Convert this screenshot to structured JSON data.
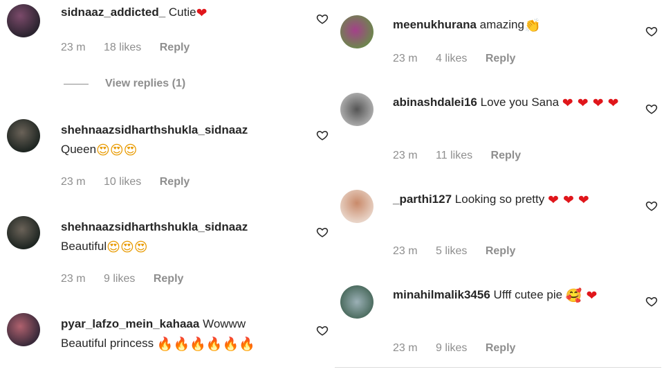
{
  "left": [
    {
      "user": "sidnaaz_addicted_",
      "text": "Cutie",
      "emoji": "❤",
      "emoji_color": "#e0161b",
      "time": "23 m",
      "likes": "18 likes",
      "reply": "Reply"
    },
    {
      "user": "shehnaazsidharthshukla_sidnaaz",
      "text": "Queen",
      "emoji": "😍😍😍",
      "emoji_color": "#f5a623",
      "time": "23 m",
      "likes": "10 likes",
      "reply": "Reply"
    },
    {
      "user": "shehnaazsidharthshukla_sidnaaz",
      "text": "Beautiful",
      "emoji": "😍😍😍",
      "emoji_color": "#f5a623",
      "time": "23 m",
      "likes": "9 likes",
      "reply": "Reply"
    },
    {
      "user": "pyar_lafzo_mein_kahaaa",
      "text": "Wowww Beautiful princess",
      "emoji": "🔥🔥🔥🔥🔥🔥",
      "emoji_color": "#f57c00"
    }
  ],
  "view_replies": "View replies (1)",
  "right": [
    {
      "user": "meenukhurana",
      "text": "amazing",
      "emoji": "👏",
      "emoji_color": "#f5b700",
      "time": "23 m",
      "likes": "4 likes",
      "reply": "Reply"
    },
    {
      "user": "abinashdalei16",
      "text": "Love you Sana",
      "emoji": "❤ ❤ ❤ ❤",
      "emoji_color": "#e0161b",
      "time": "23 m",
      "likes": "11 likes",
      "reply": "Reply"
    },
    {
      "user": "_parthi127",
      "text": "Looking so pretty",
      "emoji": "❤ ❤ ❤",
      "emoji_color": "#e0161b",
      "time": "23 m",
      "likes": "5 likes",
      "reply": "Reply"
    },
    {
      "user": "minahilmalik3456",
      "text": "Ufff cutee pie",
      "emoji": "🥰 ❤",
      "emoji_color": "#e0161b",
      "time": "23 m",
      "likes": "9 likes",
      "reply": "Reply"
    }
  ]
}
